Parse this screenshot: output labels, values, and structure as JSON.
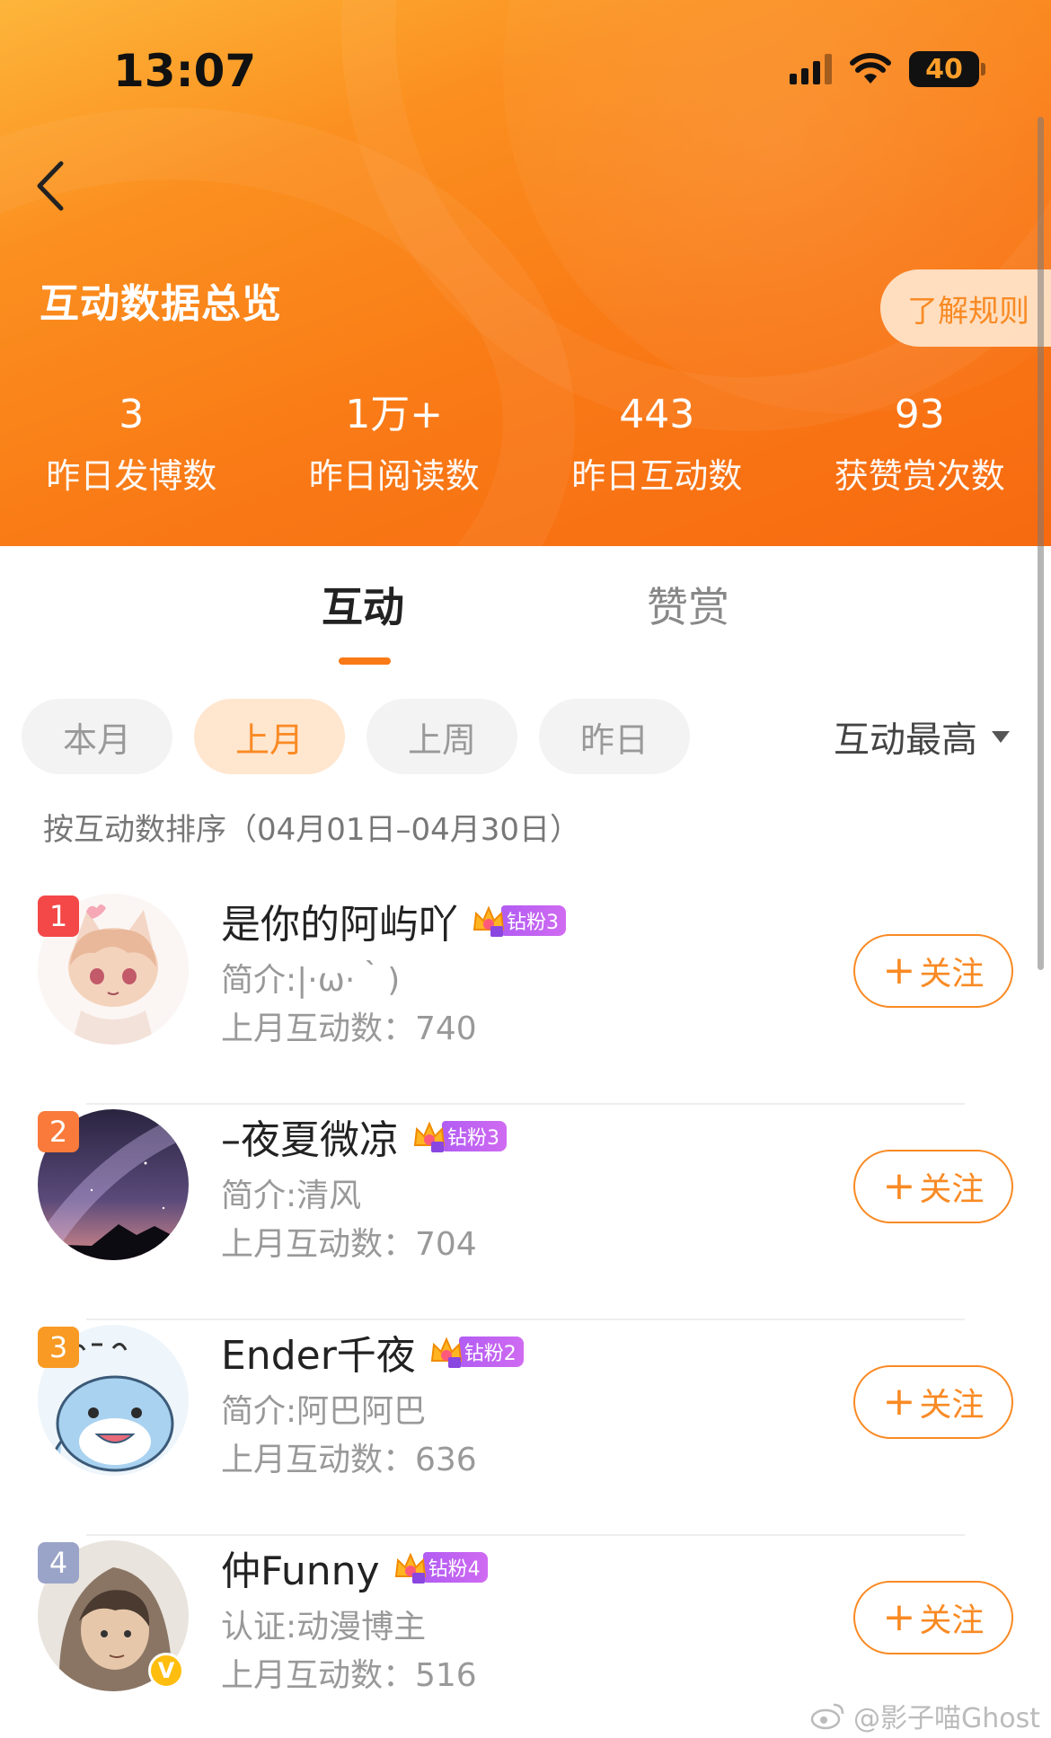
{
  "status_bar": {
    "time": "13:07",
    "battery": "40"
  },
  "header": {
    "title": "互动数据总览",
    "rules_button": "了解规则",
    "stats": [
      {
        "value": "3",
        "label": "昨日发博数"
      },
      {
        "value": "1万+",
        "label": "昨日阅读数"
      },
      {
        "value": "443",
        "label": "昨日互动数"
      },
      {
        "value": "93",
        "label": "获赞赏次数"
      }
    ]
  },
  "tabs": [
    {
      "label": "互动",
      "active": true
    },
    {
      "label": "赞赏",
      "active": false
    }
  ],
  "filters": [
    {
      "label": "本月",
      "active": false
    },
    {
      "label": "上月",
      "active": true
    },
    {
      "label": "上周",
      "active": false
    },
    {
      "label": "昨日",
      "active": false
    }
  ],
  "sort_select": {
    "value": "互动最高"
  },
  "sort_note": "按互动数排序（04月01日–04月30日）",
  "follow_label": "关注",
  "users": [
    {
      "rank": "1",
      "rank_color": "#f44848",
      "name": "是你的阿屿吖",
      "fan_level": "6",
      "fan_badge": "钻粉3",
      "intro": "简介:|·ω·｀)",
      "count": "上月互动数：740",
      "verified": false,
      "avatar_icon": "anime-fox-girl-avatar"
    },
    {
      "rank": "2",
      "rank_color": "#f97a3a",
      "name": "–夜夏微凉",
      "fan_level": "7",
      "fan_badge": "钻粉3",
      "intro": "简介:清风",
      "count": "上月互动数：704",
      "verified": false,
      "avatar_icon": "milky-way-night-avatar"
    },
    {
      "rank": "3",
      "rank_color": "#f99a24",
      "name": "Ender千夜",
      "fan_level": "5",
      "fan_badge": "钻粉2",
      "intro": "简介:阿巴阿巴",
      "count": "上月互动数：636",
      "verified": false,
      "avatar_icon": "blue-shark-cartoon-avatar"
    },
    {
      "rank": "4",
      "rank_color": "#9aa3c8",
      "name": "仲Funny",
      "fan_level": "7",
      "fan_badge": "钻粉4",
      "intro": "认证:动漫博主",
      "count": "上月互动数：516",
      "verified": true,
      "avatar_icon": "hooded-anime-boy-avatar"
    }
  ],
  "watermark": "@影子喵Ghost"
}
